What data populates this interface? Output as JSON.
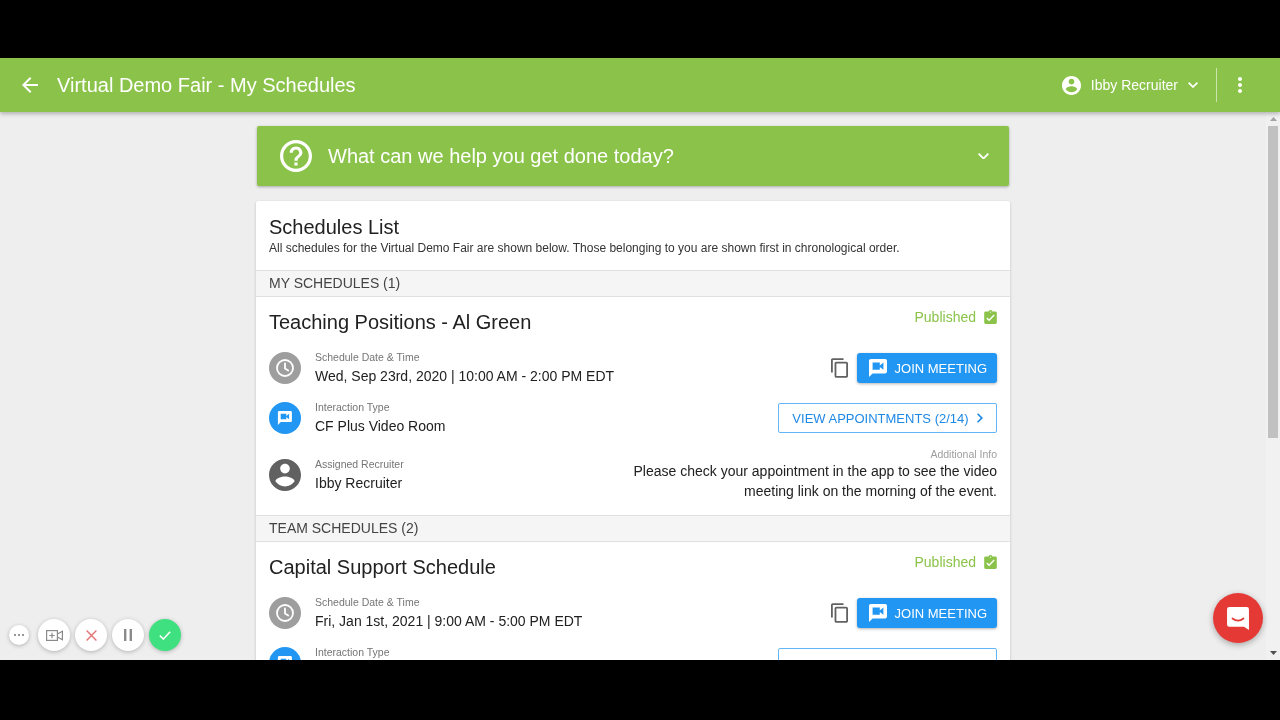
{
  "app_bar": {
    "title": "Virtual Demo Fair - My Schedules",
    "user": "Ibby Recruiter"
  },
  "help_banner": {
    "text": "What can we help you get done today?",
    "expanded": false
  },
  "schedules_list": {
    "title": "Schedules List",
    "subtitle": "All schedules for the Virtual Demo Fair are shown below. Those belonging to you are shown first in chronological order.",
    "sections": [
      {
        "heading": "MY SCHEDULES (1)",
        "schedules": [
          {
            "title": "Teaching Positions - Al Green",
            "status": "Published",
            "rows": [
              {
                "kind": "date",
                "label": "Schedule Date & Time",
                "value": "Wed, Sep 23rd, 2020 | 10:00 AM - 2:00 PM EDT",
                "action": {
                  "kind": "join",
                  "label": "JOIN MEETING"
                }
              },
              {
                "kind": "interaction",
                "label": "Interaction Type",
                "value": "CF Plus Video Room",
                "action": {
                  "kind": "appointments",
                  "label": "VIEW APPOINTMENTS (2/14)"
                }
              },
              {
                "kind": "recruiter",
                "label": "Assigned Recruiter",
                "value": "Ibby Recruiter",
                "info": {
                  "label": "Additional Info",
                  "text": "Please check your appointment in the app to see the video meeting link on the morning of the event."
                }
              }
            ]
          }
        ]
      },
      {
        "heading": "TEAM SCHEDULES (2)",
        "schedules": [
          {
            "title": "Capital Support Schedule",
            "status": "Published",
            "rows": [
              {
                "kind": "date",
                "label": "Schedule Date & Time",
                "value": "Fri, Jan 1st, 2021 | 9:00 AM - 5:00 PM EDT",
                "action": {
                  "kind": "join",
                  "label": "JOIN MEETING"
                }
              },
              {
                "kind": "interaction",
                "label": "Interaction Type",
                "action": {
                  "kind": "appointments"
                }
              }
            ]
          }
        ]
      }
    ]
  }
}
